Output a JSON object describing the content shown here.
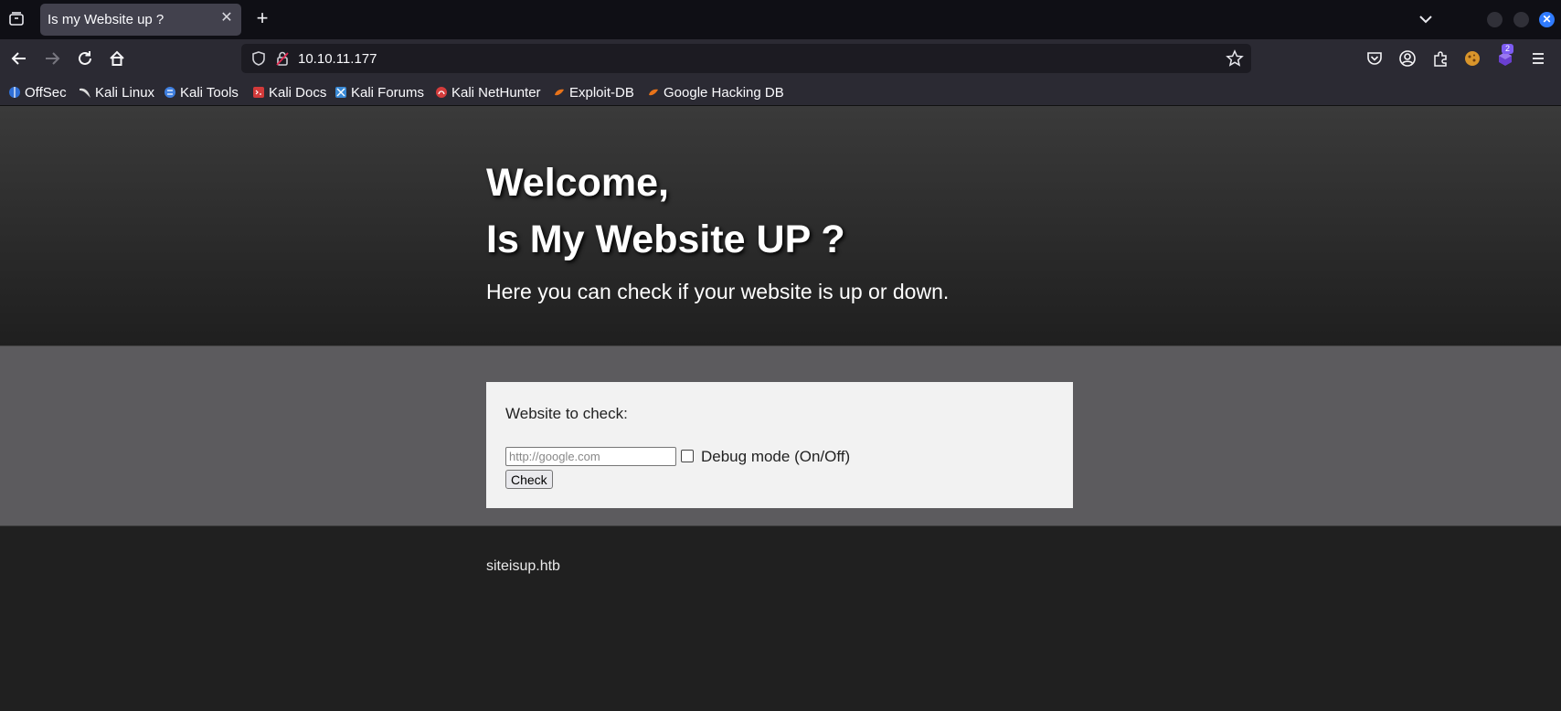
{
  "browser": {
    "tab_title": "Is my Website up ?",
    "url": "10.10.11.177",
    "extension_badge_count": "2",
    "bookmarks": [
      {
        "label": "OffSec",
        "icon": "offsec-icon",
        "color": "#2f6fd6"
      },
      {
        "label": "Kali Linux",
        "icon": "kali-dragon-icon",
        "color": "#dddddd"
      },
      {
        "label": "Kali Tools",
        "icon": "kali-tools-icon",
        "color": "#3f7fe0"
      },
      {
        "label": "Kali Docs",
        "icon": "kali-docs-icon",
        "color": "#d23a3a"
      },
      {
        "label": "Kali Forums",
        "icon": "kali-forums-icon",
        "color": "#3a8ad6"
      },
      {
        "label": "Kali NetHunter",
        "icon": "kali-nethunter-icon",
        "color": "#d43c3c"
      },
      {
        "label": "Exploit-DB",
        "icon": "exploit-db-icon",
        "color": "#e8731a"
      },
      {
        "label": "Google Hacking DB",
        "icon": "ghdb-icon",
        "color": "#e8731a"
      }
    ]
  },
  "page": {
    "heading_line1": "Welcome,",
    "heading_line2": "Is My Website UP ?",
    "subtitle": "Here you can check if your website is up or down.",
    "form": {
      "label": "Website to check:",
      "input_placeholder": "http://google.com",
      "input_value": "",
      "debug_label": "Debug mode (On/Off)",
      "debug_checked": false,
      "submit_label": "Check"
    },
    "footer_text": "siteisup.htb"
  },
  "colors": {
    "hero_top": "#3a3a3a",
    "band": "#5c5b5e",
    "card": "#f2f2f2",
    "footer": "#202020"
  }
}
